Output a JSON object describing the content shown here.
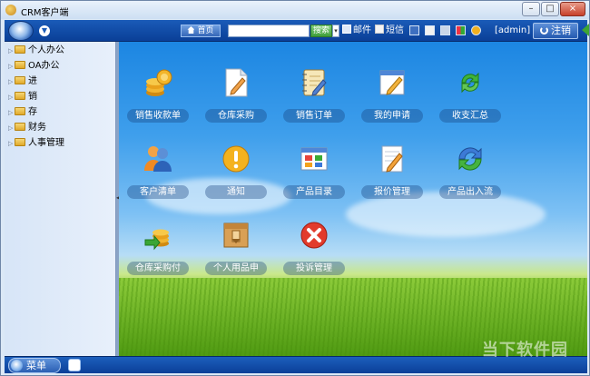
{
  "window": {
    "title": "CRM客户端",
    "controls": {
      "minimize": "–",
      "maximize": "□",
      "close": "×"
    }
  },
  "toolbar": {
    "home_label": "首页",
    "search": {
      "value": "",
      "button_label": "搜索",
      "dropdown": "▾"
    },
    "mail_label": "邮件",
    "sms_label": "短信",
    "user": "[admin]",
    "logout_label": "注销"
  },
  "sidebar": {
    "items": [
      {
        "label": "个人办公"
      },
      {
        "label": "OA办公"
      },
      {
        "label": "进"
      },
      {
        "label": "销"
      },
      {
        "label": "存"
      },
      {
        "label": "财务"
      },
      {
        "label": "人事管理"
      }
    ]
  },
  "desktop": {
    "tiles": [
      {
        "label": "销售收款单",
        "icon": "coins-icon"
      },
      {
        "label": "仓库采购",
        "icon": "document-pen-icon"
      },
      {
        "label": "销售订单",
        "icon": "notebook-pen-icon"
      },
      {
        "label": "我的申请",
        "icon": "notepad-pencil-icon"
      },
      {
        "label": "收支汇总",
        "icon": "refresh-arrows-icon"
      },
      {
        "label": "客户清单",
        "icon": "users-icon"
      },
      {
        "label": "通知",
        "icon": "alert-icon"
      },
      {
        "label": "产品目录",
        "icon": "catalog-window-icon"
      },
      {
        "label": "报价管理",
        "icon": "quote-pencil-icon"
      },
      {
        "label": "产品出入流",
        "icon": "cycle-arrows-icon"
      },
      {
        "label": "仓库采购付",
        "icon": "coin-stack-arrow-icon"
      },
      {
        "label": "个人用品申",
        "icon": "cardboard-box-icon"
      },
      {
        "label": "投诉管理",
        "icon": "close-circle-icon"
      }
    ]
  },
  "statusbar": {
    "menu_label": "菜单"
  },
  "watermark": "当下软件园"
}
